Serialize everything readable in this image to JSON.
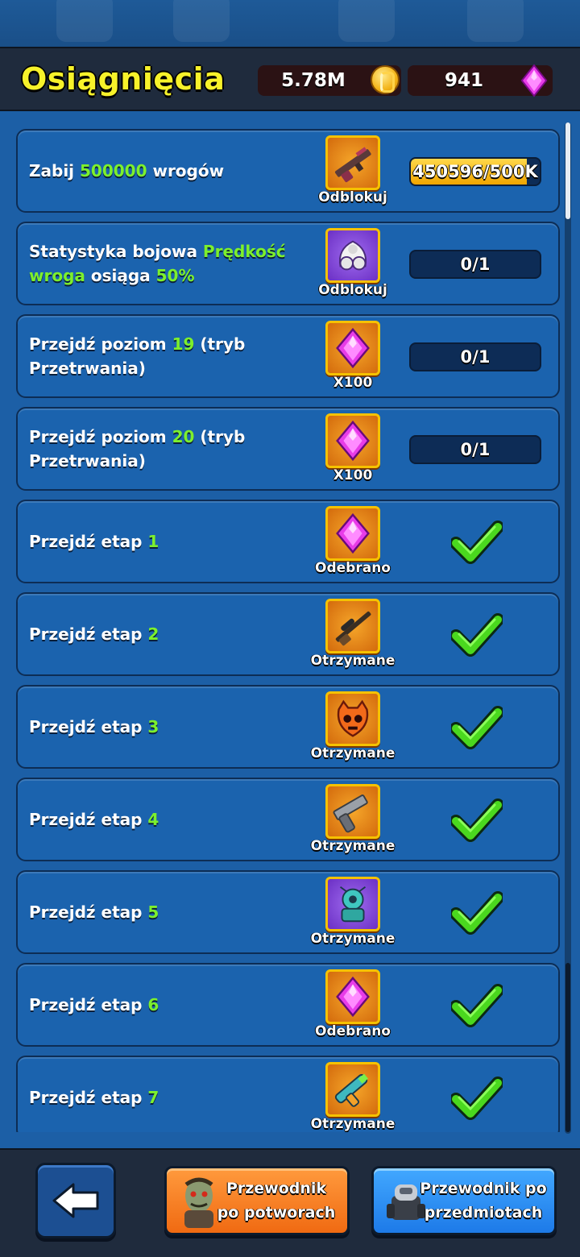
{
  "header": {
    "title": "Osiągnięcia",
    "coins": "5.78M",
    "gems": "941"
  },
  "achievements": [
    {
      "desc_parts": [
        {
          "t": "Zabij "
        },
        {
          "t": "500000",
          "hl": true
        },
        {
          "t": " wrogów"
        }
      ],
      "reward_icon": "rifle-icon",
      "reward_bg": "orange",
      "reward_label": "Odblokuj",
      "status": "progress",
      "progress_text": "450596/500K",
      "progress_fraction": 0.9
    },
    {
      "desc_parts": [
        {
          "t": "Statystyka bojowa "
        },
        {
          "t": "Prędkość wroga",
          "hl": true
        },
        {
          "t": " osiąga "
        },
        {
          "t": "50%",
          "hl": true
        }
      ],
      "reward_icon": "armor-icon",
      "reward_bg": "purple",
      "reward_label": "Odblokuj",
      "status": "progress",
      "progress_text": "0/1",
      "progress_fraction": 0
    },
    {
      "desc_parts": [
        {
          "t": "Przejdź poziom "
        },
        {
          "t": "19",
          "hl": true
        },
        {
          "t": " (tryb Przetrwania)"
        }
      ],
      "reward_icon": "gem-icon",
      "reward_bg": "orange",
      "reward_label": "X100",
      "status": "progress",
      "progress_text": "0/1",
      "progress_fraction": 0
    },
    {
      "desc_parts": [
        {
          "t": "Przejdź poziom "
        },
        {
          "t": "20",
          "hl": true
        },
        {
          "t": " (tryb Przetrwania)"
        }
      ],
      "reward_icon": "gem-icon",
      "reward_bg": "orange",
      "reward_label": "X100",
      "status": "progress",
      "progress_text": "0/1",
      "progress_fraction": 0
    },
    {
      "desc_parts": [
        {
          "t": "Przejdź etap "
        },
        {
          "t": "1",
          "hl": true
        }
      ],
      "reward_icon": "gem-icon",
      "reward_bg": "orange",
      "reward_label": "Odebrano",
      "status": "done"
    },
    {
      "desc_parts": [
        {
          "t": "Przejdź etap "
        },
        {
          "t": "2",
          "hl": true
        }
      ],
      "reward_icon": "sniper-icon",
      "reward_bg": "orange",
      "reward_label": "Otrzymane",
      "status": "done"
    },
    {
      "desc_parts": [
        {
          "t": "Przejdź etap "
        },
        {
          "t": "3",
          "hl": true
        }
      ],
      "reward_icon": "skull-mask-icon",
      "reward_bg": "orange",
      "reward_label": "Otrzymane",
      "status": "done"
    },
    {
      "desc_parts": [
        {
          "t": "Przejdź etap "
        },
        {
          "t": "4",
          "hl": true
        }
      ],
      "reward_icon": "pistol-icon",
      "reward_bg": "orange",
      "reward_label": "Otrzymane",
      "status": "done"
    },
    {
      "desc_parts": [
        {
          "t": "Przejdź etap "
        },
        {
          "t": "5",
          "hl": true
        }
      ],
      "reward_icon": "robot-turret-icon",
      "reward_bg": "purple",
      "reward_label": "Otrzymane",
      "status": "done"
    },
    {
      "desc_parts": [
        {
          "t": "Przejdź etap "
        },
        {
          "t": "6",
          "hl": true
        }
      ],
      "reward_icon": "gem-icon",
      "reward_bg": "orange",
      "reward_label": "Odebrano",
      "status": "done"
    },
    {
      "desc_parts": [
        {
          "t": "Przejdź etap "
        },
        {
          "t": "7",
          "hl": true
        }
      ],
      "reward_icon": "blaster-icon",
      "reward_bg": "orange",
      "reward_label": "Otrzymane",
      "status": "done"
    }
  ],
  "bottom": {
    "monster_guide_line1": "Przewodnik",
    "monster_guide_line2": "po potworach",
    "item_guide_line1": "Przewodnik po",
    "item_guide_line2": "przedmiotach"
  },
  "colors": {
    "title": "#f7f22a",
    "highlight": "#7df02c",
    "card": "#1b63ae",
    "check": "#4ad81e"
  }
}
